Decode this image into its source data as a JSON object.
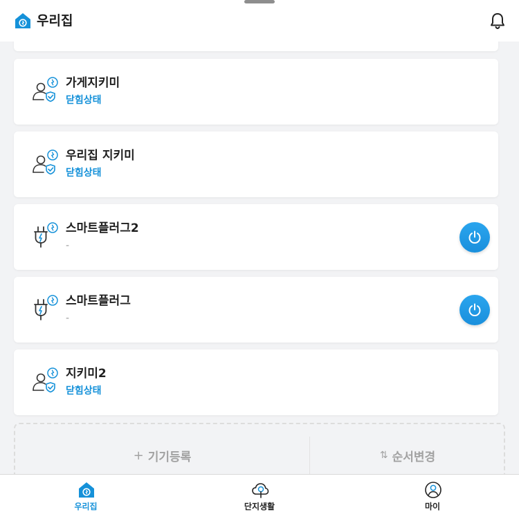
{
  "header": {
    "title": "우리집"
  },
  "devices": [
    {
      "name": "가게지키미",
      "status": "닫힘상태",
      "type": "guard",
      "has_power": false
    },
    {
      "name": "우리집 지키미",
      "status": "닫힘상태",
      "type": "guard",
      "has_power": false
    },
    {
      "name": "스마트플러그2",
      "status": "-",
      "type": "plug",
      "has_power": true
    },
    {
      "name": "스마트플러그",
      "status": "-",
      "type": "plug",
      "has_power": true
    },
    {
      "name": "지키미2",
      "status": "닫힘상태",
      "type": "guard",
      "has_power": false
    }
  ],
  "actions": {
    "add_label": "기기등록",
    "add_glyph": "+",
    "reorder_label": "순서변경",
    "reorder_glyph": "⇅"
  },
  "nav": {
    "items": [
      {
        "label": "우리집",
        "active": true,
        "icon": "home-icon"
      },
      {
        "label": "단지생활",
        "active": false,
        "icon": "community-icon"
      },
      {
        "label": "마이",
        "active": false,
        "icon": "profile-icon"
      }
    ]
  },
  "colors": {
    "accent": "#1591d9",
    "power": "#1a8fdc",
    "background": "#f2f3f5"
  }
}
